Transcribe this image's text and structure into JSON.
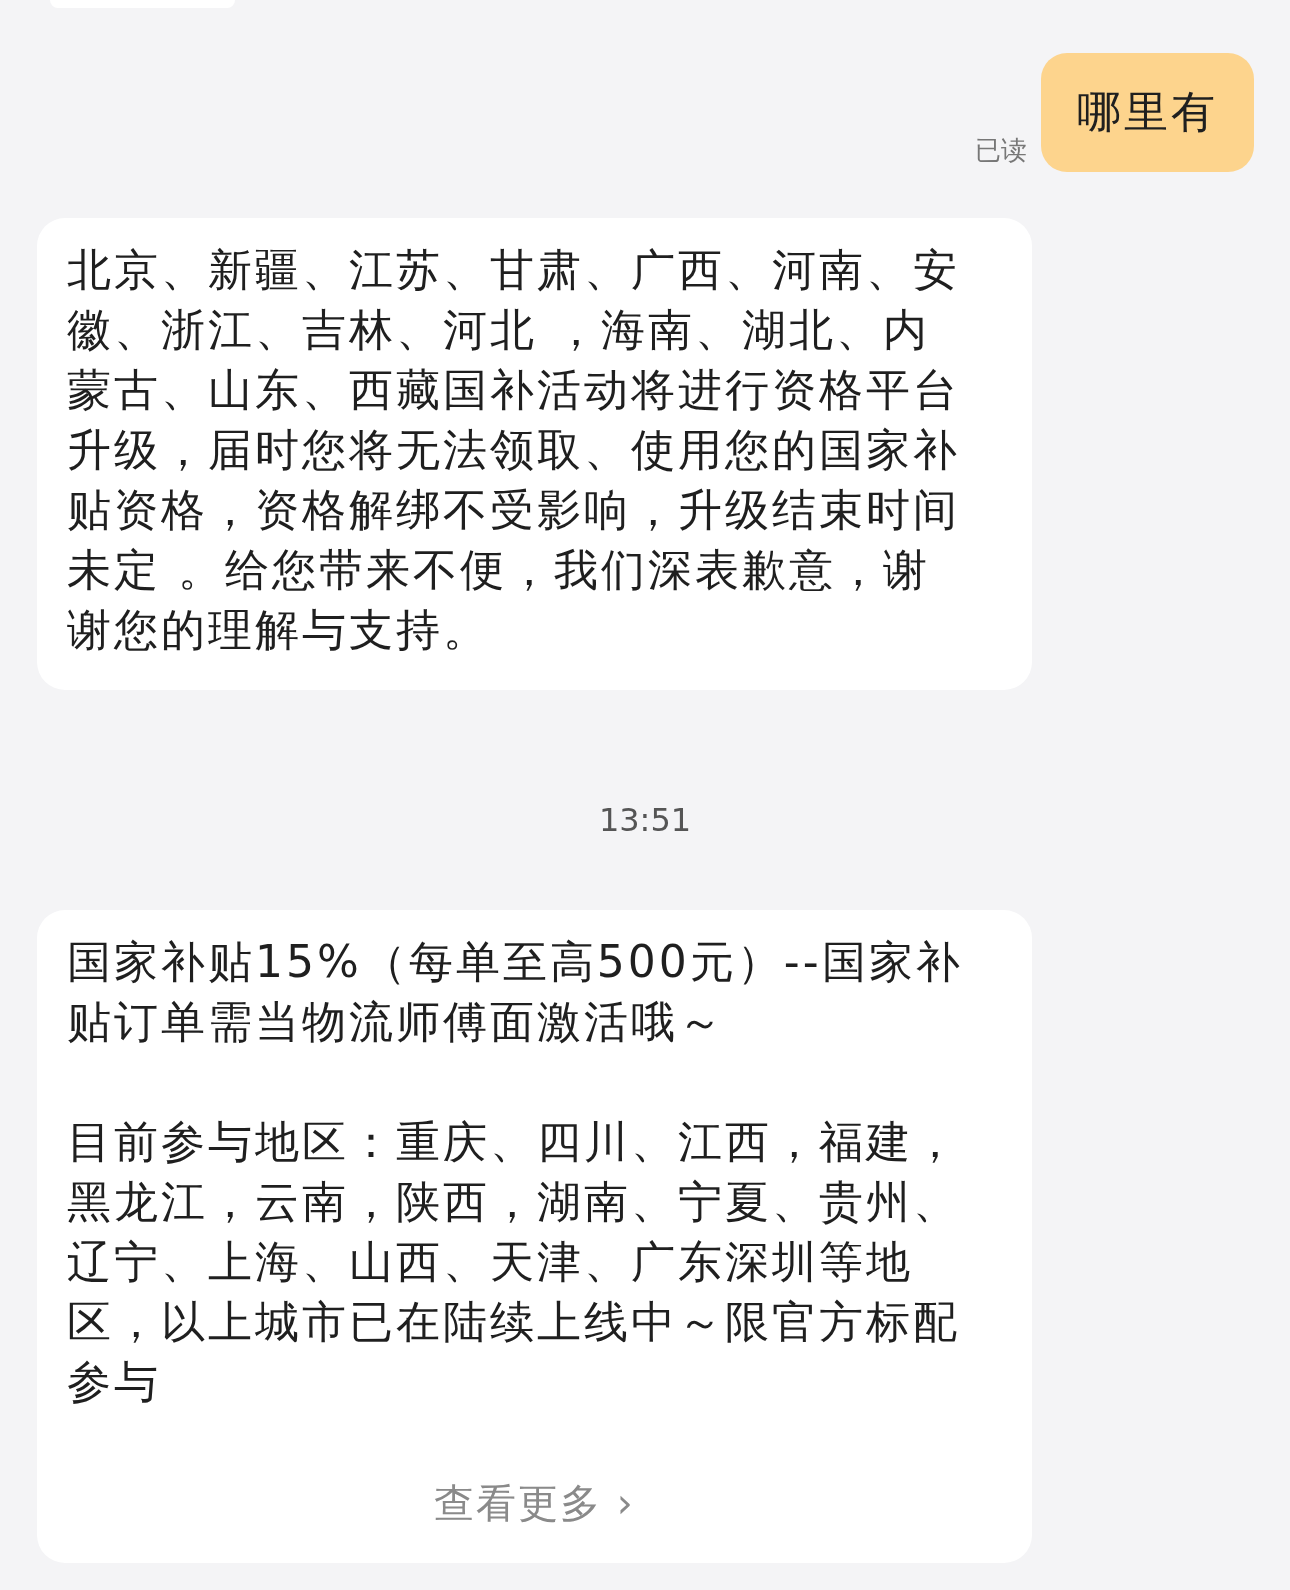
{
  "messages": [
    {
      "kind": "partial"
    },
    {
      "kind": "outgoing",
      "text": "哪里有",
      "status": "已读"
    },
    {
      "kind": "incoming",
      "paragraphs": [
        "北京、新疆、江苏、甘肃、广西、河南、安徽、浙江、吉林、河北 ，海南、湖北、内蒙古、山东、西藏国补活动将进行资格平台升级，届时您将无法领取、使用您的国家补贴资格，资格解绑不受影响，升级结束时间未定 。给您带来不便，我们深表歉意，谢谢您的理解与支持。"
      ]
    },
    {
      "kind": "timestamp",
      "text": "13:51"
    },
    {
      "kind": "incoming",
      "paragraphs": [
        "国家补贴15%（每单至高500元）--国家补贴订单需当物流师傅面激活哦～",
        "目前参与地区：重庆、四川、江西，福建，黑龙江，云南，陕西，湖南、宁夏、贵州、辽宁、上海、山西、天津、广东深圳等地区，以上城市已在陆续上线中～限官方标配参与"
      ],
      "link": "查看更多 ›"
    }
  ]
}
